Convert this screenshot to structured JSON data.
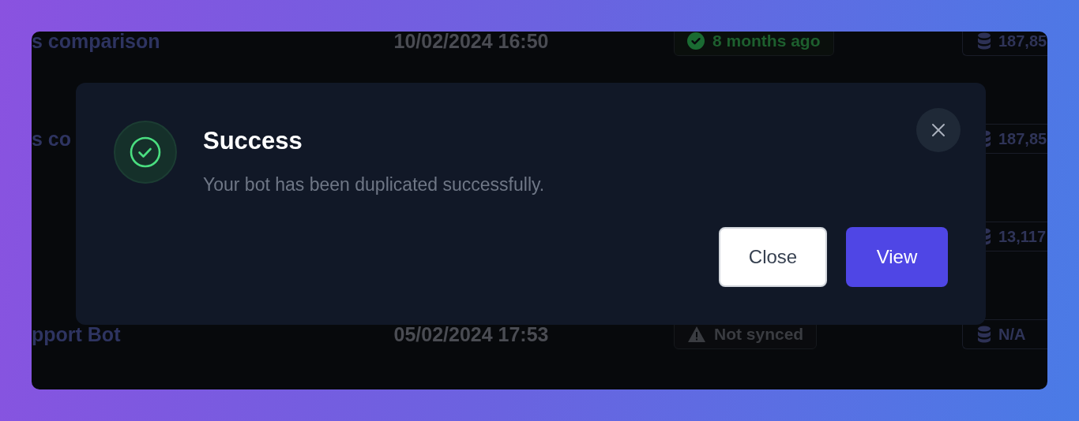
{
  "table": {
    "rows": [
      {
        "name": "s comparison",
        "date": "10/02/2024 16:50",
        "status": {
          "kind": "synced",
          "label": "8 months ago"
        },
        "tokens": "187,85"
      },
      {
        "name": "s co",
        "tokens": "187,85"
      },
      {
        "tokens": "13,117"
      },
      {
        "name": "pport Bot",
        "date": "05/02/2024 17:53",
        "status": {
          "kind": "warning",
          "label": "Not synced"
        },
        "tokens": "N/A"
      }
    ]
  },
  "dialog": {
    "kind": "success",
    "title": "Success",
    "message": "Your bot has been duplicated successfully.",
    "buttons": [
      {
        "label": "Close",
        "kind": "secondary"
      },
      {
        "label": "View",
        "kind": "primary"
      }
    ]
  }
}
